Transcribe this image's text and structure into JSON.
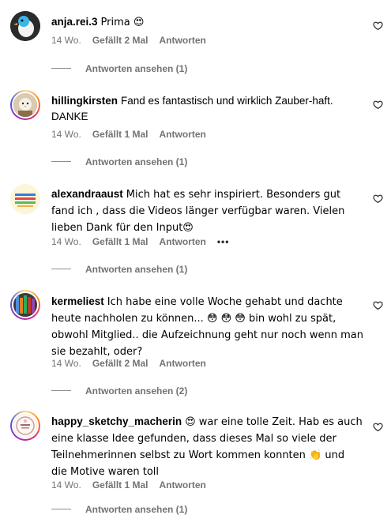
{
  "comments": [
    {
      "username": "anja.rei.3",
      "text": "Prima 😍",
      "time": "14 Wo.",
      "likes": "Gefällt 2 Mal",
      "reply": "Antworten",
      "view_replies": "Antworten ansehen (1)"
    },
    {
      "username": "hillingkirsten",
      "text": "Fand es fantastisch und wirklich Zauber-haft. DANKE",
      "time": "14 Wo.",
      "likes": "Gefällt 1 Mal",
      "reply": "Antworten",
      "view_replies": "Antworten ansehen (1)"
    },
    {
      "username": "alexandraaust",
      "text": "Mich hat es sehr inspiriert. Besonders gut fand ich , dass die Videos länger verfügbar waren. Vielen lieben Dank für den Input😍",
      "time": "14 Wo.",
      "likes": "Gefällt 1 Mal",
      "reply": "Antworten",
      "more": "•••",
      "view_replies": "Antworten ansehen (1)"
    },
    {
      "username": "kermeliest",
      "text": "Ich habe eine volle Woche gehabt und dachte heute nachholen zu können... 😳 😳 😳 bin wohl zu spät, obwohl Mitglied.. die Aufzeichnung geht nur noch wenn man sie bezahlt, oder?",
      "time": "14 Wo.",
      "likes": "Gefällt 2 Mal",
      "reply": "Antworten",
      "view_replies": "Antworten ansehen (2)"
    },
    {
      "username": "happy_sketchy_macherin",
      "text": "😍 war eine tolle Zeit. Hab es auch eine klasse Idee gefunden, dass dieses Mal so viele der Teilnehmerinnen selbst zu Wort kommen konnten 👏 und die Motive waren toll",
      "time": "14 Wo.",
      "likes": "Gefällt 1 Mal",
      "reply": "Antworten",
      "view_replies": "Antworten ansehen (1)"
    }
  ],
  "icons": {
    "like": "heart-outline-icon",
    "more": "more-options-icon"
  },
  "colors": {
    "meta": "#737373",
    "story_ring": "#d62976"
  }
}
